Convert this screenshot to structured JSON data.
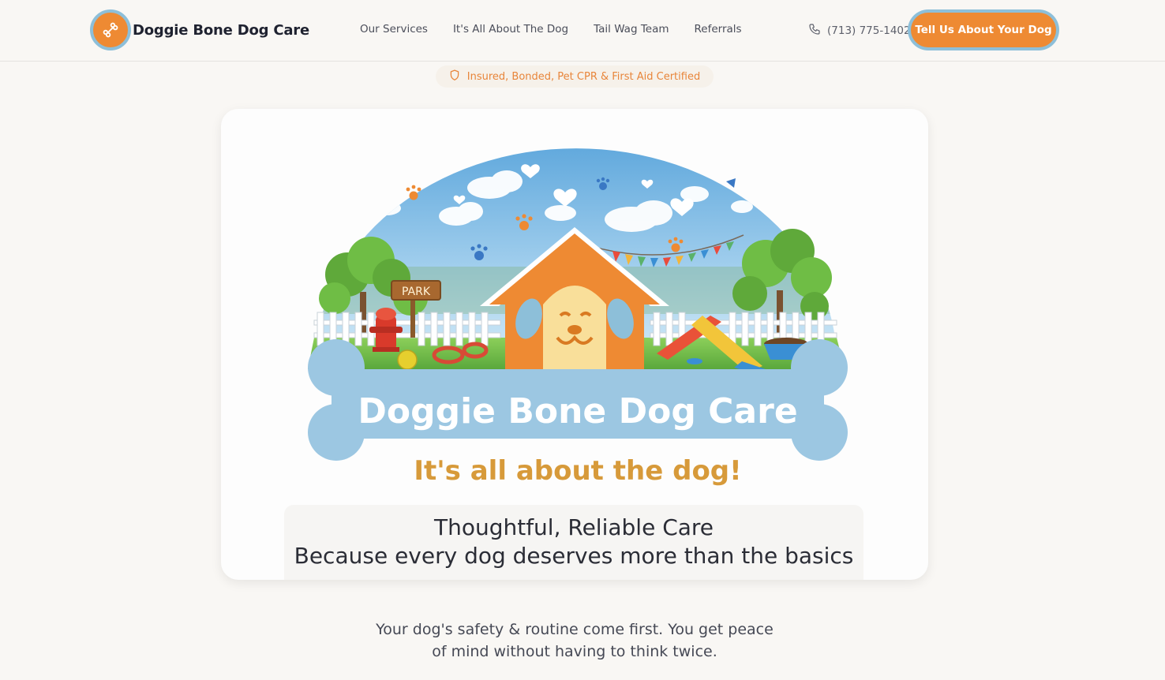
{
  "header": {
    "brand_name": "Doggie Bone Dog Care",
    "logo_icon": "bone-icon",
    "nav": [
      {
        "label": "Our Services"
      },
      {
        "label": "It's All About The Dog"
      },
      {
        "label": "Tail Wag Team"
      },
      {
        "label": "Referrals"
      }
    ],
    "phone_icon": "phone-icon",
    "phone": "(713) 775-1402",
    "cta_label": "Tell Us About Your Dog"
  },
  "badge": {
    "icon": "shield-icon",
    "text": "Insured, Bonded, Pet CPR & First Aid Certified"
  },
  "hero": {
    "sign_text": "PARK",
    "logo_title": "Doggie Bone Dog Care",
    "logo_tagline": "It's all about the dog!",
    "caption_line1": "Thoughtful, Reliable Care",
    "caption_line2": "Because every dog deserves more than the basics"
  },
  "subtext": "Your dog's safety & routine come first. You get peace of mind without having to think twice.",
  "colors": {
    "accent_orange": "#ee8a33",
    "accent_blue": "#8dbfd9",
    "background": "#f9f7f4",
    "tagline_gold": "#d79a3a"
  }
}
